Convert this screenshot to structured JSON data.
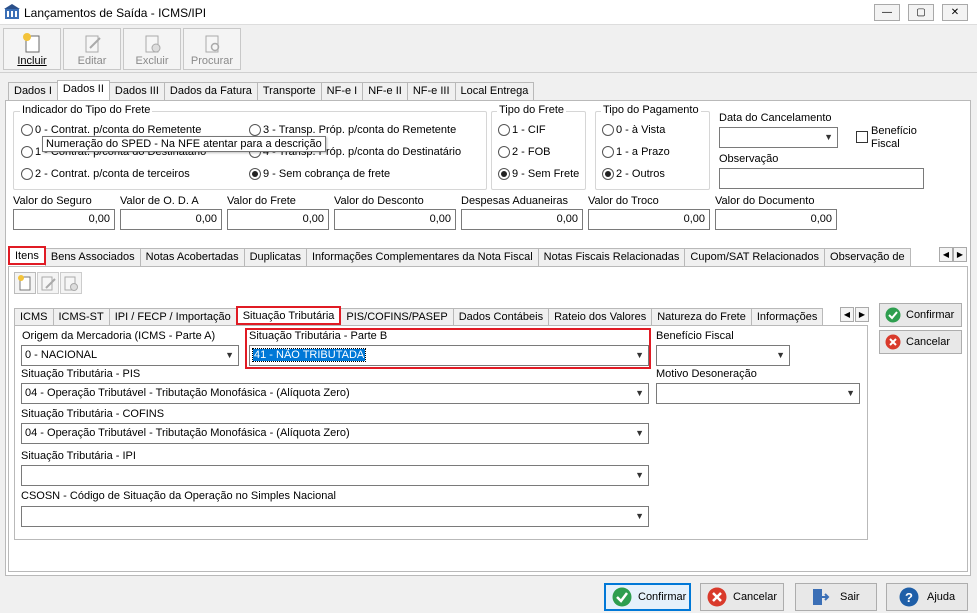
{
  "window": {
    "title": "Lançamentos de Saída - ICMS/IPI",
    "min": "—",
    "max": "▢",
    "close": "✕"
  },
  "toolbar": {
    "incluir": "Incluir",
    "editar": "Editar",
    "excluir": "Excluir",
    "procurar": "Procurar"
  },
  "main_tabs": [
    "Dados I",
    "Dados II",
    "Dados III",
    "Dados da Fatura",
    "Transporte",
    "NF-e I",
    "NF-e II",
    "NF-e III",
    "Local Entrega"
  ],
  "frete_group": {
    "label": "Indicador do Tipo do Frete",
    "opt0": "0 - Contrat. p/conta do Remetente",
    "opt1": "1 - Contrat. p/conta do Destinatário",
    "opt2": "2 - Contrat. p/conta de terceiros",
    "opt3": "3 - Transp. Próp. p/conta do Remetente",
    "opt4": "4 - Transp. Próp. p/conta do Destinatário",
    "opt9": "9 - Sem cobrança de frete"
  },
  "tooltip": "Numeração do SPED - Na NFE atentar para a descrição",
  "tipo_frete": {
    "label": "Tipo do Frete",
    "o1": "1 - CIF",
    "o2": "2 - FOB",
    "o9": "9 - Sem Frete"
  },
  "tipo_pagamento": {
    "label": "Tipo do Pagamento",
    "o0": "0 - à Vista",
    "o1": "1 - a Prazo",
    "o2": "2 - Outros"
  },
  "data_cancelamento": {
    "label": "Data do Cancelamento",
    "value": ""
  },
  "beneficio_fiscal_chk": "Benefício Fiscal",
  "observacao": {
    "label": "Observação",
    "value": ""
  },
  "valores": {
    "seguro": {
      "label": "Valor do Seguro",
      "value": "0,00"
    },
    "oda": {
      "label": "Valor de O. D. A",
      "value": "0,00"
    },
    "frete": {
      "label": "Valor do Frete",
      "value": "0,00"
    },
    "desconto": {
      "label": "Valor do Desconto",
      "value": "0,00"
    },
    "aduaneiras": {
      "label": "Despesas Aduaneiras",
      "value": "0,00"
    },
    "troco": {
      "label": "Valor do Troco",
      "value": "0,00"
    },
    "documento": {
      "label": "Valor do Documento",
      "value": "0,00"
    }
  },
  "sub_tabs": [
    "Itens",
    "Bens Associados",
    "Notas Acobertadas",
    "Duplicatas",
    "Informações Complementares da Nota Fiscal",
    "Notas Fiscais Relacionadas",
    "Cupom/SAT Relacionados",
    "Observação de"
  ],
  "item_tabs": [
    "ICMS",
    "ICMS-ST",
    "IPI / FECP / Importação",
    "Situação Tributária",
    "PIS/COFINS/PASEP",
    "Dados Contábeis",
    "Rateio dos Valores",
    "Natureza do Frete",
    "Informações"
  ],
  "form": {
    "origem": {
      "label": "Origem da Mercadoria (ICMS - Parte A)",
      "value": "0 - NACIONAL"
    },
    "sit_b": {
      "label": "Situação Tributária - Parte B",
      "value": "41 - NÃO TRIBUTADA"
    },
    "beneficio": {
      "label": "Benefício Fiscal",
      "value": ""
    },
    "pis": {
      "label": "Situação Tributária - PIS",
      "value": "04 - Operação Tributável - Tributação Monofásica - (Alíquota Zero)"
    },
    "motivo": {
      "label": "Motivo Desoneração",
      "value": ""
    },
    "cofins": {
      "label": "Situação Tributária - COFINS",
      "value": "04 - Operação Tributável - Tributação Monofásica - (Alíquota Zero)"
    },
    "ipi": {
      "label": "Situação Tributária - IPI",
      "value": ""
    },
    "csosn": {
      "label": "CSOSN - Código de Situação da Operação no Simples Nacional",
      "value": ""
    }
  },
  "side_buttons": {
    "confirmar": "Confirmar",
    "cancelar": "Cancelar"
  },
  "footer": {
    "confirmar": "Confirmar",
    "cancelar": "Cancelar",
    "sair": "Sair",
    "ajuda": "Ajuda"
  },
  "colors": {
    "accent": "#0078d7",
    "highlight": "#e01b24",
    "green": "#2e9e4f",
    "red": "#d93a2b"
  }
}
